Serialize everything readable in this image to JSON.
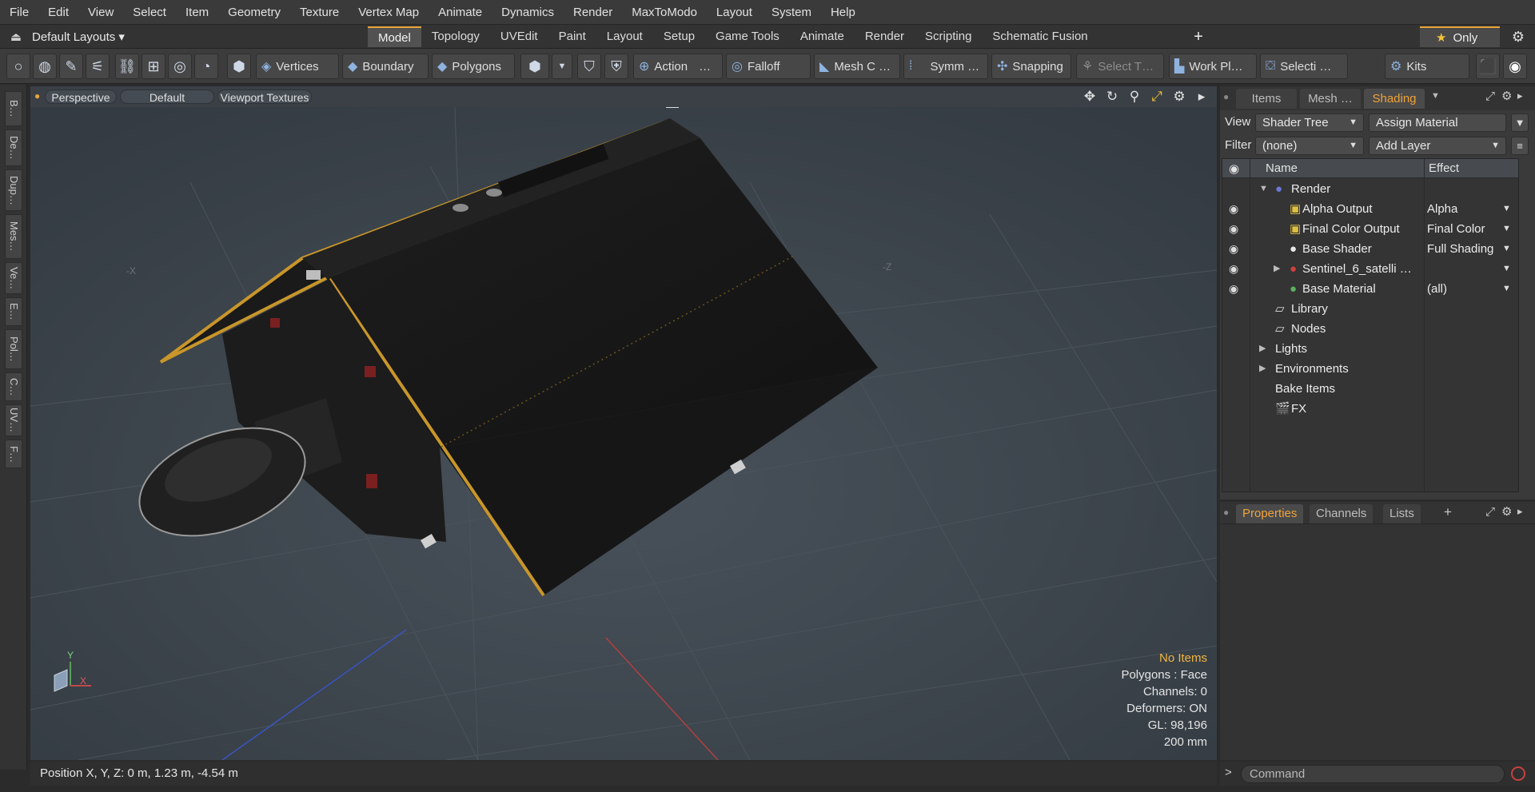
{
  "menu": [
    "File",
    "Edit",
    "View",
    "Select",
    "Item",
    "Geometry",
    "Texture",
    "Vertex Map",
    "Animate",
    "Dynamics",
    "Render",
    "MaxToModo",
    "Layout",
    "System",
    "Help"
  ],
  "layoutbar": {
    "default_layouts": "Default Layouts ▾",
    "tabs": [
      "Model",
      "Topology",
      "UVEdit",
      "Paint",
      "Layout",
      "Setup",
      "Game Tools",
      "Animate",
      "Render",
      "Scripting",
      "Schematic Fusion"
    ],
    "active_tab": "Model",
    "add": "+",
    "only": "Only"
  },
  "toolbar": {
    "vertices": "Vertices",
    "boundary": "Boundary",
    "polygons": "Polygons",
    "action": "Action",
    "action_more": "…",
    "falloff": "Falloff",
    "meshc": "Mesh C …",
    "symm": "Symm …",
    "snapping": "Snapping",
    "selectt": "Select T…",
    "workpl": "Work Pl…",
    "selecti": "Selecti …",
    "kits": "Kits"
  },
  "lefttabs": [
    "B…",
    "De…",
    "Dup…",
    "Mes…",
    "Ve…",
    "E…",
    "Pol…",
    "C…",
    "UV…",
    "F…"
  ],
  "viewport": {
    "perspective": "Perspective",
    "default": "Default",
    "viewport_textures": "Viewport Textures",
    "axis_neg_x": "-X",
    "axis_neg_z": "-Z",
    "gizmo_y": "Y",
    "gizmo_x": "X",
    "info": {
      "no_items": "No Items",
      "polygons": "Polygons : Face",
      "channels": "Channels: 0",
      "deformers": "Deformers: ON",
      "gl": "GL: 98,196",
      "scale": "200 mm"
    }
  },
  "status": {
    "position": "Position X, Y, Z:  0 m, 1.23 m, -4.54 m"
  },
  "right": {
    "tabs": [
      "Items",
      "Mesh …",
      "Shading"
    ],
    "view_label": "View",
    "view_value": "Shader Tree",
    "assign_material": "Assign Material",
    "filter_label": "Filter",
    "filter_value": "(none)",
    "add_layer": "Add Layer",
    "col_name": "Name",
    "col_effect": "Effect",
    "tree": [
      {
        "name": "Render",
        "effect": ""
      },
      {
        "name": "Alpha Output",
        "effect": "Alpha"
      },
      {
        "name": "Final Color Output",
        "effect": "Final Color"
      },
      {
        "name": "Base Shader",
        "effect": "Full Shading"
      },
      {
        "name": "Sentinel_6_satelli …",
        "effect": ""
      },
      {
        "name": "Base Material",
        "effect": "(all)"
      },
      {
        "name": "Library",
        "effect": ""
      },
      {
        "name": "Nodes",
        "effect": ""
      },
      {
        "name": "Lights",
        "effect": ""
      },
      {
        "name": "Environments",
        "effect": ""
      },
      {
        "name": "Bake Items",
        "effect": ""
      },
      {
        "name": "FX",
        "effect": ""
      }
    ]
  },
  "properties": {
    "tabs": [
      "Properties",
      "Channels",
      "Lists"
    ],
    "add": "+"
  },
  "command": {
    "placeholder": "Command",
    "prompt": ">"
  },
  "colors": {
    "accent": "#e8a53a",
    "viewport_bg": "#3d454c",
    "panel": "#3a3a3a",
    "record": "#c84040"
  }
}
